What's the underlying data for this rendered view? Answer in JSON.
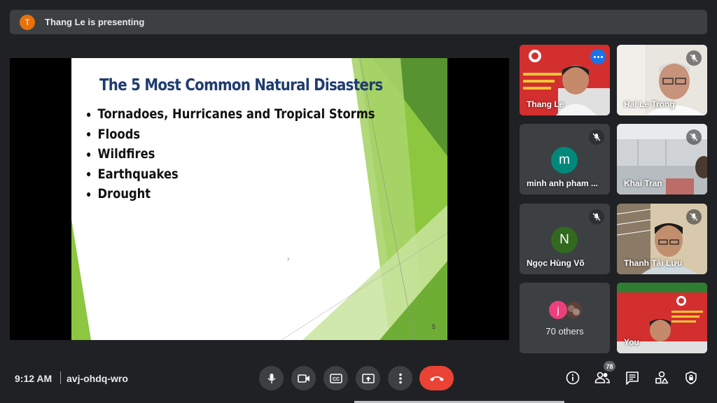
{
  "presenting": {
    "avatar_letter": "T",
    "avatar_color": "#e8710a",
    "text": "Thang Le is presenting"
  },
  "slide": {
    "title": "The 5 Most Common Natural Disasters",
    "bullets": [
      "Tornadoes, Hurricanes and Tropical Storms",
      "Floods",
      "Wildfires",
      "Earthquakes",
      "Drought"
    ],
    "page_number": "5",
    "title_color": "#1f3c6e",
    "accent_green": "#8dc63f"
  },
  "participants": [
    {
      "name": "Thang Le",
      "kind": "video-presenter",
      "active": true
    },
    {
      "name": "Hai Le Trong",
      "kind": "video",
      "muted": true
    },
    {
      "name": "minh anh pham ...",
      "kind": "avatar",
      "letter": "m",
      "color": "#00897b",
      "muted": true
    },
    {
      "name": "Khai Tran",
      "kind": "video",
      "muted": true
    },
    {
      "name": "Ngọc Hùng Võ",
      "kind": "avatar",
      "letter": "N",
      "color": "#33691e",
      "muted": true
    },
    {
      "name": "Thanh Tài Lưu",
      "kind": "video",
      "muted": true
    },
    {
      "name": "70 others",
      "kind": "others",
      "letter": "j",
      "color": "#ec407a"
    },
    {
      "name": "You",
      "kind": "video-self"
    }
  ],
  "bottom_bar": {
    "time": "9:12 AM",
    "meeting_code": "avj-ohdq-wro",
    "controls": [
      "mic-icon",
      "camera-icon",
      "captions-icon",
      "present-icon",
      "more-options-icon",
      "end-call-icon"
    ],
    "people_count": "78",
    "right_icons": [
      "info-icon",
      "people-icon",
      "chat-icon",
      "activities-icon",
      "host-controls-icon"
    ],
    "end_call_color": "#ea4335"
  }
}
